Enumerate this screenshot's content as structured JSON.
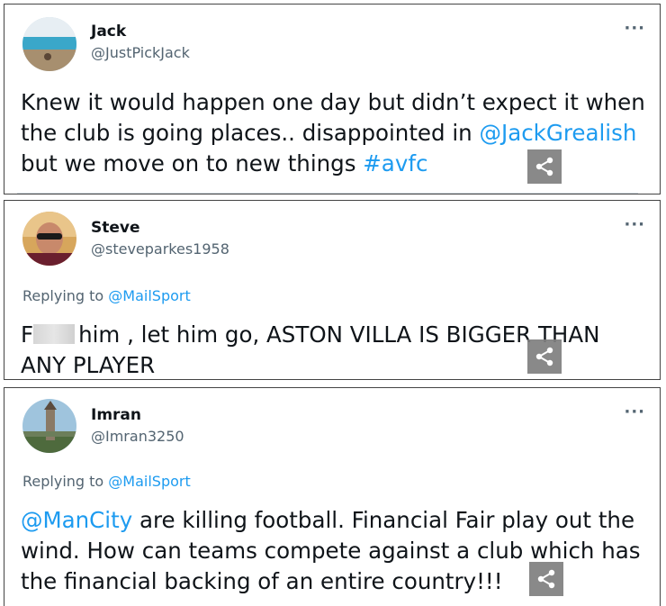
{
  "tweets": [
    {
      "name": "Jack",
      "handle": "@JustPickJack",
      "more": "···",
      "text_part1": "Knew it would happen one day but didn’t expect it when the club is going places.. disappointed in ",
      "mention": "@JackGrealish",
      "text_part2": " but we move on to new things ",
      "hashtag": "#avfc"
    },
    {
      "name": "Steve",
      "handle": "@steveparkes1958",
      "more": "···",
      "replying_prefix": "Replying to ",
      "replying_to": "@MailSport",
      "text_start": "F",
      "text_rest": "him , let him go, ASTON VILLA IS BIGGER THAN ANY PLAYER"
    },
    {
      "name": "Imran",
      "handle": "@Imran3250",
      "more": "···",
      "replying_prefix": "Replying to ",
      "replying_to": "@MailSport",
      "mention": "@ManCity",
      "text_rest": " are killing football. Financial Fair play out the wind. How can teams compete against a club which has the financial backing of an entire country!!!"
    }
  ],
  "colors": {
    "link": "#1d9bf0",
    "secondary": "#536471",
    "share_bg": "#7f7f7f"
  },
  "icons": [
    "share-icon",
    "more-options-icon",
    "avatar"
  ]
}
